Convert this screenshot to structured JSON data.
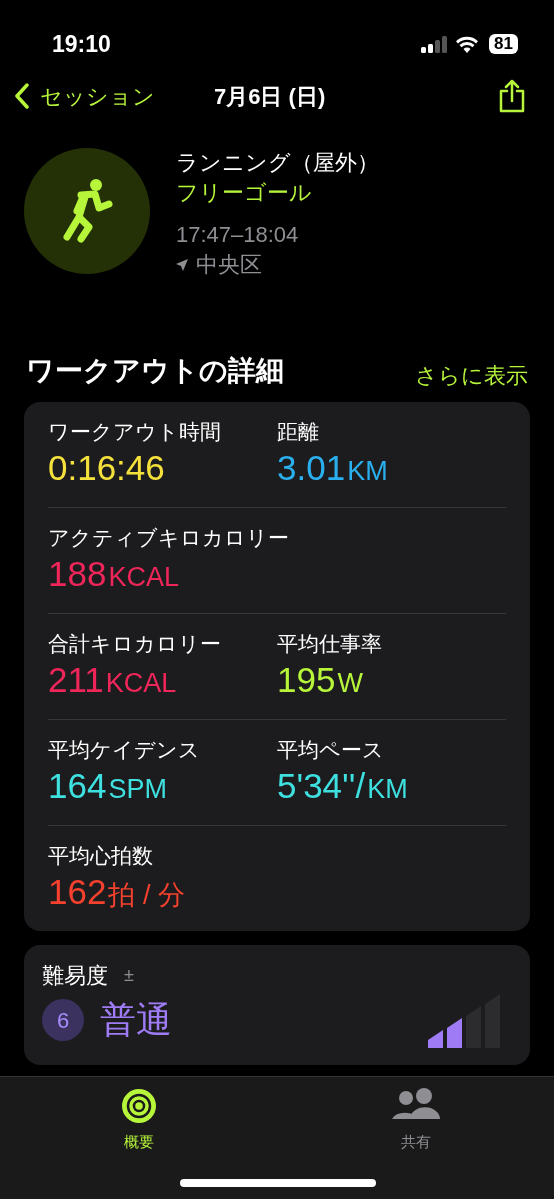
{
  "status_bar": {
    "time": "19:10",
    "battery": "81"
  },
  "nav": {
    "back": "セッション",
    "title": "7月6日 (日)"
  },
  "workout": {
    "type": "ランニング（屋外）",
    "goal": "フリーゴール",
    "time_range": "17:47–18:04",
    "location": "中央区"
  },
  "details": {
    "title": "ワークアウトの詳細",
    "more": "さらに表示",
    "rows": [
      [
        {
          "label": "ワークアウト時間",
          "value": "0:16:46",
          "color": "#f5e13b"
        },
        {
          "label": "距離",
          "value": "3.01",
          "unit": "KM",
          "color": "#2ab0ef"
        }
      ],
      [
        {
          "label": "アクティブキロカロリー",
          "value": "188",
          "unit": "KCAL",
          "color": "#f0265a"
        }
      ],
      [
        {
          "label": "合計キロカロリー",
          "value": "211",
          "unit": "KCAL",
          "color": "#f0265a"
        },
        {
          "label": "平均仕事率",
          "value": "195",
          "unit": "W",
          "color": "#b6f53a"
        }
      ],
      [
        {
          "label": "平均ケイデンス",
          "value": "164",
          "unit": "SPM",
          "color": "#3ee0e0"
        },
        {
          "label": "平均ペース",
          "value": "5'34''/",
          "unit": "KM",
          "color": "#3ee0e0"
        }
      ],
      [
        {
          "label": "平均心拍数",
          "value": "162",
          "unit": "拍 / 分",
          "color": "#f5412d"
        }
      ]
    ]
  },
  "difficulty": {
    "title": "難易度",
    "badge": "±",
    "score": "6",
    "label": "普通",
    "level": 0.5
  },
  "tab_bar": [
    {
      "label": "概要",
      "selected": true
    },
    {
      "label": "共有",
      "selected": false
    }
  ]
}
